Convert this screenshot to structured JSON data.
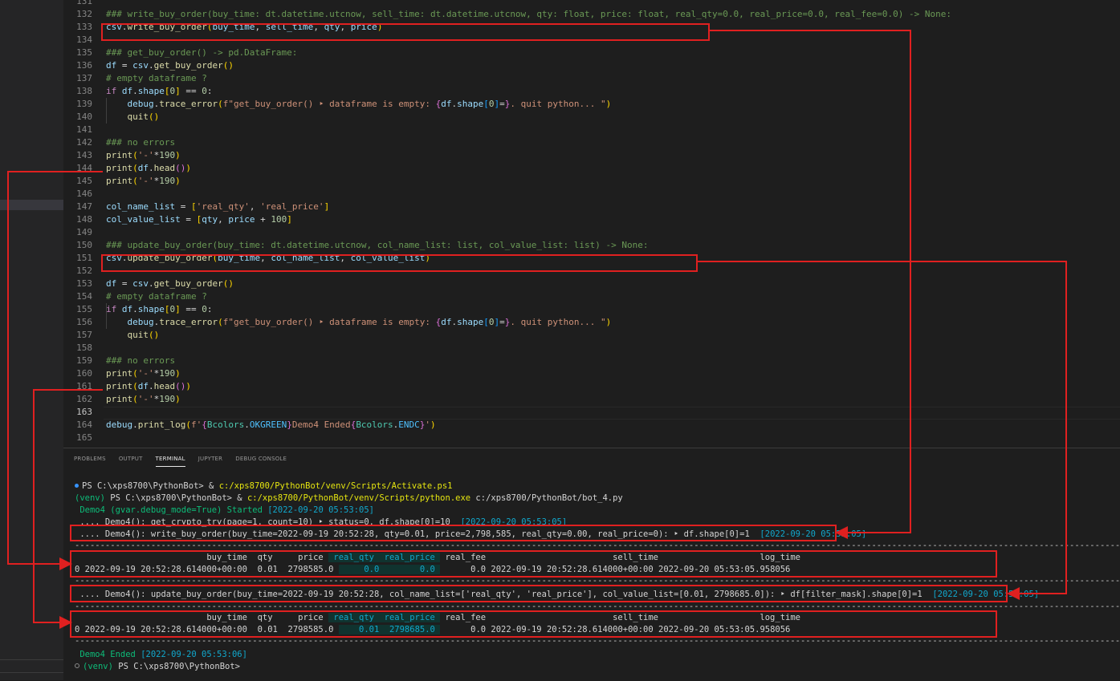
{
  "editor": {
    "lines": [
      {
        "n": "131",
        "html": ""
      },
      {
        "n": "132",
        "html": "<span class='cm'>### write_buy_order(buy_time: dt.datetime.utcnow, sell_time: dt.datetime.utcnow, qty: float, price: float, real_qty=0.0, real_price=0.0, real_fee=0.0) -> None:</span>"
      },
      {
        "n": "133",
        "html": "<span class='vr'>csv</span>.<span class='fn'>write_buy_order</span><span class='br'>(</span><span class='vr'>buy_time</span>, <span class='vr'>sell_time</span>, <span class='vr'>qty</span>, <span class='vr'>price</span><span class='br'>)</span>"
      },
      {
        "n": "134",
        "html": ""
      },
      {
        "n": "135",
        "html": "<span class='cm'>### get_buy_order() -> pd.DataFrame:</span>"
      },
      {
        "n": "136",
        "html": "<span class='vr'>df</span> = <span class='vr'>csv</span>.<span class='fn'>get_buy_order</span><span class='br'>()</span>"
      },
      {
        "n": "137",
        "html": "<span class='cm'># empty dataframe ?</span>"
      },
      {
        "n": "138",
        "html": "<span class='kw'>if</span> <span class='vr'>df</span>.<span class='vr'>shape</span><span class='br'>[</span><span class='nm'>0</span><span class='br'>]</span> == <span class='nm'>0</span>:"
      },
      {
        "n": "139",
        "html": "    <span class='vr'>debug</span>.<span class='fn'>trace_error</span><span class='br'>(</span><span class='st'>f\"get_buy_order() ‣ dataframe is empty: </span><span class='br2'>{</span><span class='vr'>df</span>.<span class='vr'>shape</span><span class='br3'>[</span><span class='nm'>0</span><span class='br3'>]</span>=<span class='br2'>}</span><span class='st'>. quit python... \"</span><span class='br'>)</span>"
      },
      {
        "n": "140",
        "html": "    <span class='fn'>quit</span><span class='br'>()</span>"
      },
      {
        "n": "141",
        "html": ""
      },
      {
        "n": "142",
        "html": "<span class='cm'>### no errors</span>"
      },
      {
        "n": "143",
        "html": "<span class='fn'>print</span><span class='br'>(</span><span class='st'>'-'</span>*<span class='nm'>190</span><span class='br'>)</span>"
      },
      {
        "n": "144",
        "html": "<span class='fn'>print</span><span class='br'>(</span><span class='vr'>df</span>.<span class='fn'>head</span><span class='br2'>()</span><span class='br'>)</span>"
      },
      {
        "n": "145",
        "html": "<span class='fn'>print</span><span class='br'>(</span><span class='st'>'-'</span>*<span class='nm'>190</span><span class='br'>)</span>"
      },
      {
        "n": "146",
        "html": ""
      },
      {
        "n": "147",
        "html": "<span class='vr'>col_name_list</span> = <span class='br'>[</span><span class='st'>'real_qty'</span>, <span class='st'>'real_price'</span><span class='br'>]</span>"
      },
      {
        "n": "148",
        "html": "<span class='vr'>col_value_list</span> = <span class='br'>[</span><span class='vr'>qty</span>, <span class='vr'>price</span> + <span class='nm'>100</span><span class='br'>]</span>"
      },
      {
        "n": "149",
        "html": ""
      },
      {
        "n": "150",
        "html": "<span class='cm'>### update_buy_order(buy_time: dt.datetime.utcnow, col_name_list: list, col_value_list: list) -> None:</span>"
      },
      {
        "n": "151",
        "html": "<span class='vr'>csv</span>.<span class='fn'>update_buy_order</span><span class='br'>(</span><span class='vr'>buy_time</span>, <span class='vr'>col_name_list</span>, <span class='vr'>col_value_list</span><span class='br'>)</span>"
      },
      {
        "n": "152",
        "html": ""
      },
      {
        "n": "153",
        "html": "<span class='vr'>df</span> = <span class='vr'>csv</span>.<span class='fn'>get_buy_order</span><span class='br'>()</span>"
      },
      {
        "n": "154",
        "html": "<span class='cm'># empty dataframe ?</span>"
      },
      {
        "n": "155",
        "html": "<span class='kw'>if</span> <span class='vr'>df</span>.<span class='vr'>shape</span><span class='br'>[</span><span class='nm'>0</span><span class='br'>]</span> == <span class='nm'>0</span>:"
      },
      {
        "n": "156",
        "html": "    <span class='vr'>debug</span>.<span class='fn'>trace_error</span><span class='br'>(</span><span class='st'>f\"get_buy_order() ‣ dataframe is empty: </span><span class='br2'>{</span><span class='vr'>df</span>.<span class='vr'>shape</span><span class='br3'>[</span><span class='nm'>0</span><span class='br3'>]</span>=<span class='br2'>}</span><span class='st'>. quit python... \"</span><span class='br'>)</span>"
      },
      {
        "n": "157",
        "html": "    <span class='fn'>quit</span><span class='br'>()</span>"
      },
      {
        "n": "158",
        "html": ""
      },
      {
        "n": "159",
        "html": "<span class='cm'>### no errors</span>"
      },
      {
        "n": "160",
        "html": "<span class='fn'>print</span><span class='br'>(</span><span class='st'>'-'</span>*<span class='nm'>190</span><span class='br'>)</span>"
      },
      {
        "n": "161",
        "html": "<span class='fn'>print</span><span class='br'>(</span><span class='vr'>df</span>.<span class='fn'>head</span><span class='br2'>()</span><span class='br'>)</span>"
      },
      {
        "n": "162",
        "html": "<span class='fn'>print</span><span class='br'>(</span><span class='st'>'-'</span>*<span class='nm'>190</span><span class='br'>)</span>"
      },
      {
        "n": "163",
        "html": ""
      },
      {
        "n": "164",
        "html": "<span class='vr'>debug</span>.<span class='fn'>print_log</span><span class='br'>(</span><span class='st'>f'</span><span class='br2'>{</span><span class='cl'>Bcolors</span>.<span class='cn'>OKGREEN</span><span class='br2'>}</span><span class='st'>Demo4 Ended</span><span class='br2'>{</span><span class='cl'>Bcolors</span>.<span class='cn'>ENDC</span><span class='br2'>}</span><span class='st'>'</span><span class='br'>)</span>"
      },
      {
        "n": "165",
        "html": ""
      }
    ],
    "current_line": "163"
  },
  "panel": {
    "tabs": [
      "PROBLEMS",
      "OUTPUT",
      "TERMINAL",
      "JUPYTER",
      "DEBUG CONSOLE"
    ],
    "active_tab": "TERMINAL"
  },
  "terminal": {
    "lines": [
      {
        "html": "<span class='dot blue'></span>PS C:\\xps8700\\PythonBot> &amp; <span class='t-yellow'>c:/xps8700/PythonBot/venv/Scripts/Activate.ps1</span>"
      },
      {
        "html": "<span class='t-green'>(venv)</span> PS C:\\xps8700\\PythonBot> &amp; <span class='t-yellow'>c:/xps8700/PythonBot/venv/Scripts/python.exe</span> c:/xps8700/PythonBot/bot_4.py"
      },
      {
        "html": " <span class='t-green'>Demo4 (gvar.debug_mode=True) Started</span> <span class='t-cyan'>[2022-09-20 05:53:05]</span>"
      },
      {
        "html": " .... Demo4(): get_crypto_try(page=1, count=10) ‣ status=0, df.shape[0]=10  <span class='t-cyan'>[2022-09-20 05:53:05]</span>"
      },
      {
        "html": " .... Demo4(): write_buy_order(buy_time=2022-09-19 20:52:28, qty=0.01, price=2,798,585, real_qty=0.00, real_price=0): ‣ df.shape[0]=1  <span class='t-cyan'>[2022-09-20 05:53:05]</span>"
      },
      {
        "html": "<span class='t-dash'>----------------------------------------------------------------------------------------------------------------------------------------------------------------------------------------------------------------</span>"
      },
      {
        "html": "                          buy_time  qty     price <span class='cell-hl'> real_qty </span><span class='cell-hl'> real_price </span> real_fee                         sell_time                    log_time"
      },
      {
        "html": "0 2022-09-19 20:52:28.614000+00:00  0.01  2798585.0 <span class='cell-hl'>     0.0 </span><span class='cell-hl'>       0.0 </span>      0.0 2022-09-19 20:52:28.614000+00:00 2022-09-20 05:53:05.958056"
      },
      {
        "html": "<span class='t-dash'>----------------------------------------------------------------------------------------------------------------------------------------------------------------------------------------------------------------</span>"
      },
      {
        "html": " .... Demo4(): update_buy_order(buy_time=2022-09-19 20:52:28, col_name_list=['real_qty', 'real_price'], col_value_list=[0.01, 2798685.0]): ‣ df[filter_mask].shape[0]=1  <span class='t-cyan'>[2022-09-20 05:53:05]</span>"
      },
      {
        "html": "<span class='t-dash'>----------------------------------------------------------------------------------------------------------------------------------------------------------------------------------------------------------------</span>"
      },
      {
        "html": "                          buy_time  qty     price <span class='cell-hl'> real_qty </span><span class='cell-hl'> real_price </span> real_fee                         sell_time                    log_time"
      },
      {
        "html": "0 2022-09-19 20:52:28.614000+00:00  0.01  2798585.0 <span class='cell-hl'>    0.01 </span><span class='cell-hl'> 2798685.0 </span>      0.0 2022-09-19 20:52:28.614000+00:00 2022-09-20 05:53:05.958056"
      },
      {
        "html": "<span class='t-dash'>----------------------------------------------------------------------------------------------------------------------------------------------------------------------------------------------------------------</span>"
      },
      {
        "html": " <span class='t-green'>Demo4 Ended</span> <span class='t-cyan'>[2022-09-20 05:53:06]</span>"
      },
      {
        "html": "<span class='dot hollow'></span><span class='t-green'>(venv)</span> PS C:\\xps8700\\PythonBot>"
      }
    ]
  },
  "annotation_color": "#e02020"
}
